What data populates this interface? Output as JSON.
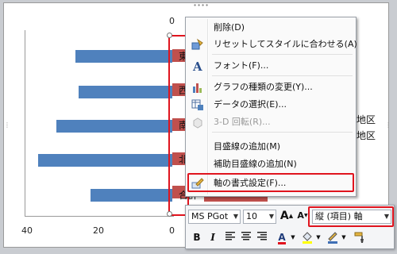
{
  "chart": {
    "ticks_top": [
      "0"
    ],
    "ticks_bottom": [
      "40",
      "20",
      "0"
    ],
    "categories_left": [
      "東",
      "西",
      "南",
      "北",
      "合計"
    ],
    "right_labels": [
      "地区",
      "地区"
    ],
    "chart_data": {
      "type": "bar",
      "orientation": "horizontal",
      "xlim": [
        40,
        0
      ],
      "series": [
        {
          "color": "#4f81bd",
          "values": [
            26,
            25,
            31,
            36,
            22
          ]
        },
        {
          "color": "#c0504d"
        }
      ]
    }
  },
  "context_menu": {
    "items": [
      {
        "label": "削除(D)",
        "icon": "none",
        "disabled": false
      },
      {
        "label": "リセットしてスタイルに合わせる(A)",
        "icon": "reset-style-icon",
        "disabled": false
      },
      {
        "label": "フォント(F)...",
        "icon": "font-icon",
        "disabled": false
      },
      {
        "label": "グラフの種類の変更(Y)...",
        "icon": "chart-type-icon",
        "disabled": false
      },
      {
        "label": "データの選択(E)...",
        "icon": "select-data-icon",
        "disabled": false
      },
      {
        "label": "3-D 回転(R)...",
        "icon": "3d-rotation-icon",
        "disabled": true
      },
      {
        "label": "目盛線の追加(M)",
        "icon": "none",
        "disabled": false
      },
      {
        "label": "補助目盛線の追加(N)",
        "icon": "none",
        "disabled": false
      },
      {
        "label": "軸の書式設定(F)...",
        "icon": "format-axis-icon",
        "disabled": false
      }
    ]
  },
  "mini_toolbar": {
    "font_name": "MS PGot",
    "font_size": "10",
    "element_selector": "縦 (項目) 軸",
    "grow_font": "A",
    "shrink_font": "A",
    "bold": "B",
    "italic": "I",
    "font_color_glyph": "A"
  }
}
